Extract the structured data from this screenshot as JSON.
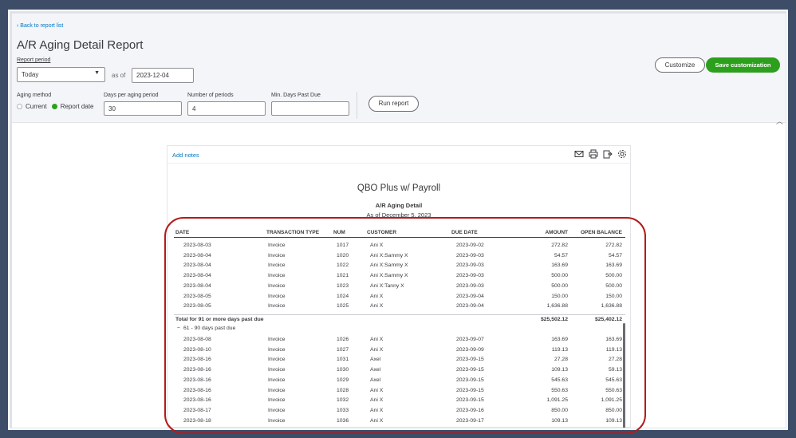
{
  "header": {
    "back_link": "Back to report list",
    "title": "A/R Aging Detail Report",
    "report_period_label": "Report period",
    "period_value": "Today",
    "as_of_label": "as of",
    "as_of_date": "2023-12-04",
    "aging_method_label": "Aging method",
    "aging_current": "Current",
    "aging_report_date": "Report date",
    "days_per_period_label": "Days per aging period",
    "days_per_period_value": "30",
    "num_periods_label": "Number of periods",
    "num_periods_value": "4",
    "min_days_label": "Min. Days Past Due",
    "min_days_value": "",
    "run_report": "Run report",
    "customize": "Customize",
    "save_customization": "Save customization"
  },
  "report": {
    "add_notes": "Add notes",
    "company": "QBO Plus w/ Payroll",
    "name": "A/R Aging Detail",
    "as_of": "As of December 5, 2023",
    "columns": [
      "DATE",
      "TRANSACTION TYPE",
      "NUM",
      "CUSTOMER",
      "DUE DATE",
      "AMOUNT",
      "OPEN BALANCE"
    ],
    "rows_91": [
      [
        "2023-08-03",
        "Invoice",
        "1017",
        "Ani X",
        "2023-09-02",
        "272.82",
        "272.82"
      ],
      [
        "2023-08-04",
        "Invoice",
        "1020",
        "Ani X:Sammy X",
        "2023-09-03",
        "54.57",
        "54.57"
      ],
      [
        "2023-08-04",
        "Invoice",
        "1022",
        "Ani X:Sammy X",
        "2023-09-03",
        "163.69",
        "163.69"
      ],
      [
        "2023-08-04",
        "Invoice",
        "1021",
        "Ani X:Sammy X",
        "2023-09-03",
        "500.00",
        "500.00"
      ],
      [
        "2023-08-04",
        "Invoice",
        "1023",
        "Ani X:Tanny X",
        "2023-09-03",
        "500.00",
        "500.00"
      ],
      [
        "2023-08-05",
        "Invoice",
        "1024",
        "Ani X",
        "2023-09-04",
        "150.00",
        "150.00"
      ],
      [
        "2023-08-05",
        "Invoice",
        "1025",
        "Ani X",
        "2023-09-04",
        "1,636.88",
        "1,636.88"
      ]
    ],
    "total_91_label": "Total for 91 or more days past due",
    "total_91_amount": "$25,502.12",
    "total_91_open": "$25,402.12",
    "section_61_label": "61 - 90 days past due",
    "rows_61": [
      [
        "2023-08-08",
        "Invoice",
        "1026",
        "Ani X",
        "2023-09-07",
        "163.69",
        "163.69"
      ],
      [
        "2023-08-10",
        "Invoice",
        "1027",
        "Ani X",
        "2023-09-09",
        "119.13",
        "119.13"
      ],
      [
        "2023-08-16",
        "Invoice",
        "1031",
        "Axel",
        "2023-09-15",
        "27.28",
        "27.28"
      ],
      [
        "2023-08-16",
        "Invoice",
        "1030",
        "Axel",
        "2023-09-15",
        "109.13",
        "59.13"
      ],
      [
        "2023-08-16",
        "Invoice",
        "1029",
        "Axel",
        "2023-09-15",
        "545.63",
        "545.63"
      ],
      [
        "2023-08-16",
        "Invoice",
        "1028",
        "Ani X",
        "2023-09-15",
        "550.63",
        "550.63"
      ],
      [
        "2023-08-16",
        "Invoice",
        "1032",
        "Ani X",
        "2023-09-15",
        "1,091.25",
        "1,091.25"
      ],
      [
        "2023-08-17",
        "Invoice",
        "1033",
        "Ani X",
        "2023-09-16",
        "850.00",
        "850.00"
      ],
      [
        "2023-08-18",
        "Invoice",
        "1036",
        "Ani X",
        "2023-09-17",
        "109.13",
        "109.13"
      ]
    ]
  },
  "colors": {
    "accent_green": "#2ca01c",
    "link_blue": "#0077c5",
    "highlight_red": "#b31b1b"
  }
}
